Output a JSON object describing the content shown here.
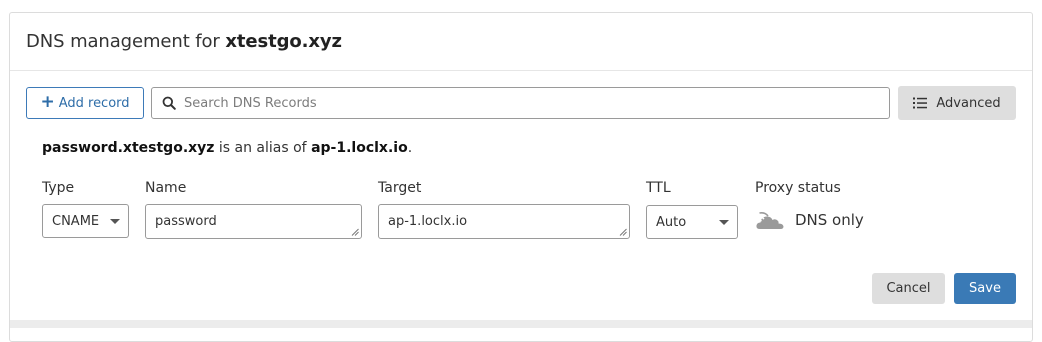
{
  "header": {
    "title_prefix": "DNS management for",
    "domain": "xtestgo.xyz"
  },
  "toolbar": {
    "add_record_label": "Add record",
    "search_placeholder": "Search DNS Records",
    "advanced_label": "Advanced"
  },
  "alias_note": {
    "host": "password.xtestgo.xyz",
    "middle_text": "is an alias of",
    "target": "ap-1.loclx.io",
    "end": "."
  },
  "form": {
    "type": {
      "label": "Type",
      "value": "CNAME"
    },
    "name": {
      "label": "Name",
      "value": "password"
    },
    "target": {
      "label": "Target",
      "value": "ap-1.loclx.io"
    },
    "ttl": {
      "label": "TTL",
      "value": "Auto"
    },
    "proxy": {
      "label": "Proxy status",
      "value": "DNS only"
    }
  },
  "actions": {
    "cancel_label": "Cancel",
    "save_label": "Save"
  },
  "icons": {
    "search": "search-icon",
    "advanced": "list-icon",
    "proxy": "cloud-icon",
    "add": "plus-icon"
  },
  "colors": {
    "accent": "#3a7ab6",
    "button_gray": "#dedede",
    "border": "#9a9a9a"
  }
}
